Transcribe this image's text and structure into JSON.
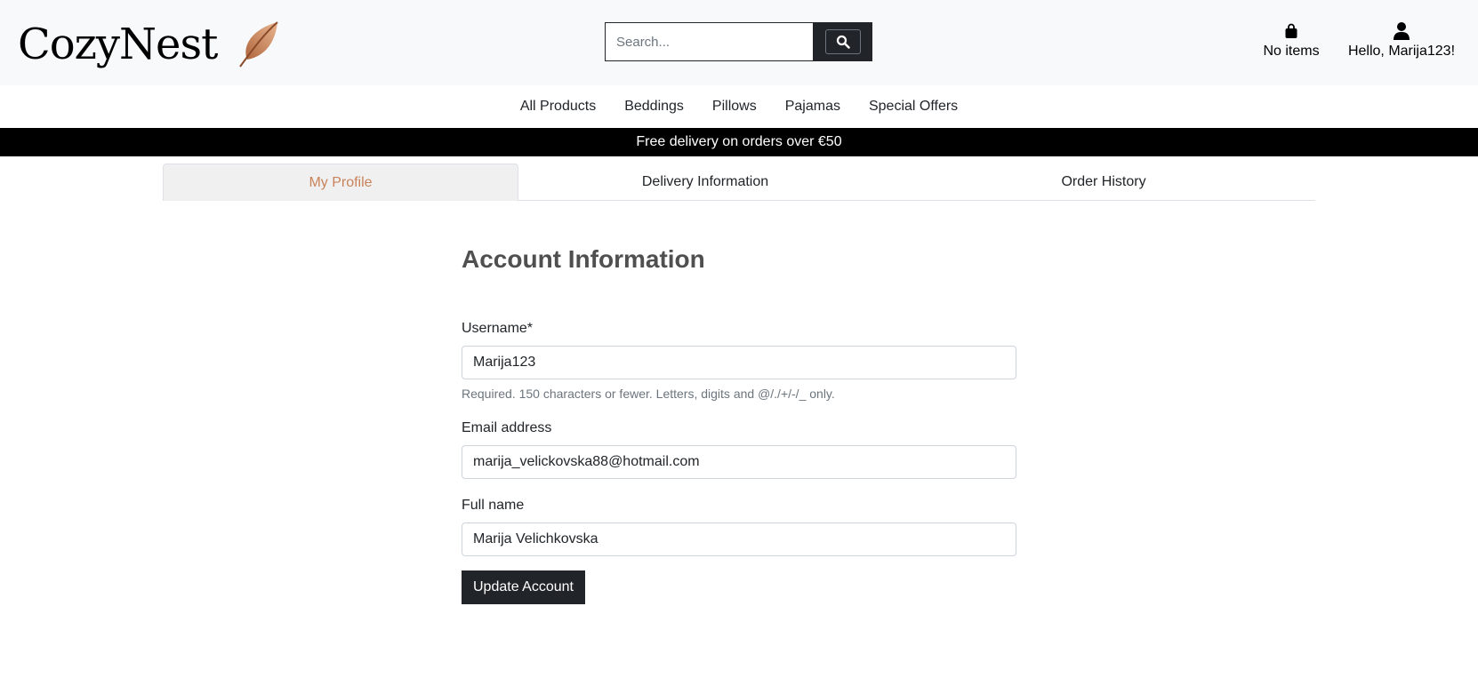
{
  "header": {
    "logo_text": "CozyNest",
    "search_placeholder": "Search...",
    "bag_label": "No items",
    "account_label": "Hello, Marija123!"
  },
  "nav": {
    "items": [
      "All Products",
      "Beddings",
      "Pillows",
      "Pajamas",
      "Special Offers"
    ]
  },
  "banner": {
    "text": "Free delivery on orders over €50"
  },
  "tabs": [
    {
      "label": "My Profile",
      "active": true
    },
    {
      "label": "Delivery Information",
      "active": false
    },
    {
      "label": "Order History",
      "active": false
    }
  ],
  "form": {
    "title": "Account Information",
    "username_label": "Username*",
    "username_value": "Marija123",
    "username_help": "Required. 150 characters or fewer. Letters, digits and @/./+/-/_ only.",
    "email_label": "Email address",
    "email_value": "marija_velickovska88@hotmail.com",
    "fullname_label": "Full name",
    "fullname_value": "Marija Velichkovska",
    "submit_label": "Update Account"
  },
  "colors": {
    "accent": "#c9835a",
    "dark": "#212529",
    "header_bg": "#f8f9fa",
    "banner_bg": "#000000"
  },
  "icons": [
    "feather-logo-icon",
    "search-icon",
    "shopping-bag-icon",
    "user-icon"
  ]
}
